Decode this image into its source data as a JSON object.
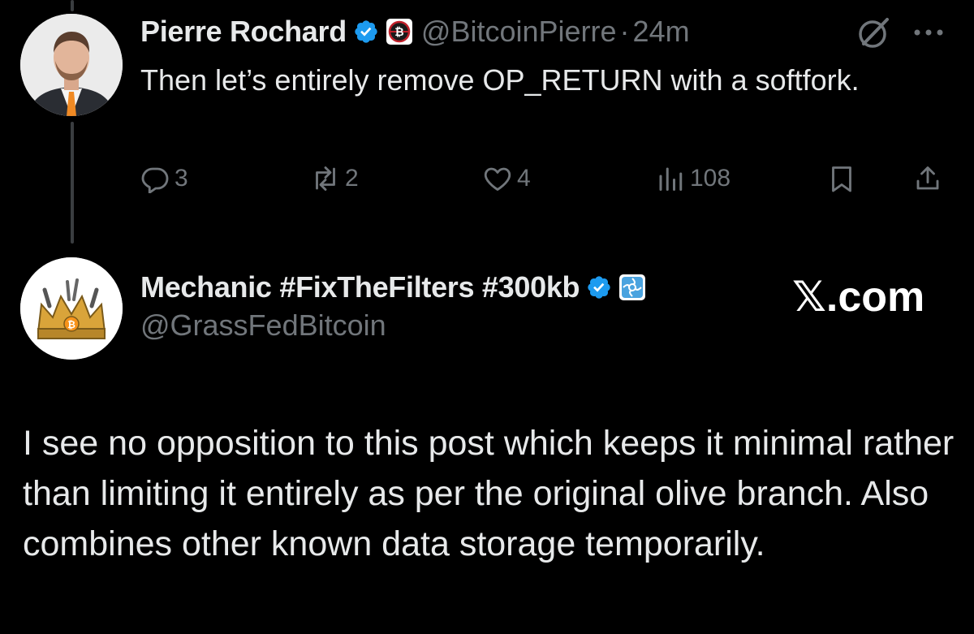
{
  "tweet1": {
    "display_name": "Pierre Rochard",
    "handle": "@BitcoinPierre",
    "separator": "·",
    "time": "24m",
    "text": "Then let’s entirely remove OP_RETURN with a softfork.",
    "actions": {
      "reply_count": "3",
      "repost_count": "2",
      "like_count": "4",
      "views_count": "108"
    },
    "verified_color": "#1d9bf0"
  },
  "tweet2": {
    "display_name": "Mechanic #FixTheFilters #300kb",
    "handle": "@GrassFedBitcoin",
    "text": "I see no opposition to this post which keeps it minimal rather than limiting it entirely as per the original olive branch. Also combines other known data storage temporarily.",
    "verified_color": "#1d9bf0"
  },
  "watermark": "𝕏.com",
  "icons": {
    "verified": "verified-badge-icon",
    "affiliate_pierre": "bitcoin-affiliate-icon",
    "affiliate_mechanic": "blue-flower-affiliate-icon",
    "grok": "grok-icon",
    "more": "more-dots-icon",
    "reply": "reply-icon",
    "repost": "repost-icon",
    "like": "heart-icon",
    "views": "views-chart-icon",
    "bookmark": "bookmark-icon",
    "share": "share-icon"
  },
  "colors": {
    "background": "#000000",
    "text": "#e7e9ea",
    "muted": "#71767b",
    "verified": "#1d9bf0"
  }
}
